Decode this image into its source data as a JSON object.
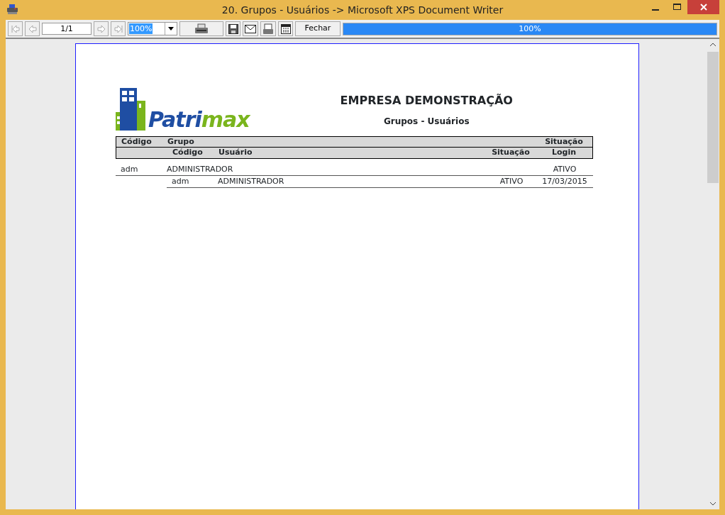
{
  "window": {
    "title": "20. Grupos - Usuários -> Microsoft XPS Document Writer"
  },
  "toolbar": {
    "page": "1/1",
    "zoom": "100%",
    "close_button": "Fechar",
    "progress": {
      "level": 1,
      "reading": "100%"
    }
  },
  "report": {
    "logo_text": [
      "Patri",
      "max"
    ],
    "company": "EMPRESA DEMONSTRAÇÃO",
    "title": "Grupos - Usuários",
    "header_1": [
      "Código",
      "Grupo",
      "Situação"
    ],
    "header_2": [
      "Código",
      "Usuário",
      "Situação",
      "Login"
    ],
    "groups": [
      {
        "code": "adm",
        "name": "ADMINISTRADOR",
        "status": "ATIVO",
        "users": [
          {
            "code": "adm",
            "name": "ADMINISTRADOR",
            "status": "ATIVO",
            "login": "17/03/2015"
          }
        ]
      }
    ]
  }
}
